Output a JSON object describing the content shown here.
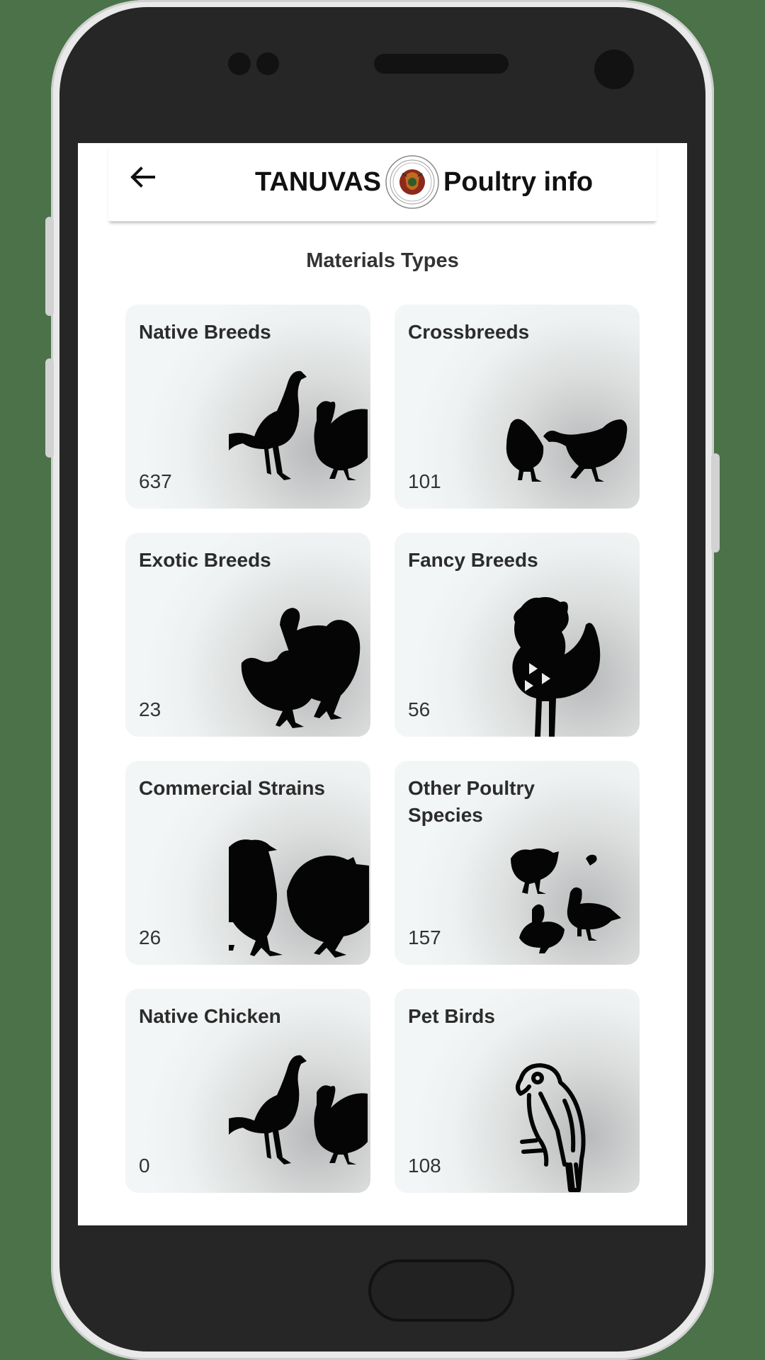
{
  "app_bar": {
    "title_left": "TANUVAS",
    "title_right": "Poultry info",
    "back_icon": "arrow-left-icon",
    "logo": "tanuvas-logo"
  },
  "section_title": "Materials Types",
  "cards": [
    {
      "title": "Native Breeds",
      "count": "637",
      "icon": "native-breeds-icon"
    },
    {
      "title": "Crossbreeds",
      "count": "101",
      "icon": "crossbreeds-icon"
    },
    {
      "title": "Exotic Breeds",
      "count": "23",
      "icon": "exotic-breeds-icon"
    },
    {
      "title": "Fancy Breeds",
      "count": "56",
      "icon": "fancy-breeds-icon"
    },
    {
      "title": "Commercial Strains",
      "count": "26",
      "icon": "commercial-strains-icon"
    },
    {
      "title": "Other Poultry Species",
      "count": "157",
      "icon": "other-poultry-icon"
    },
    {
      "title": "Native Chicken",
      "count": "0",
      "icon": "native-chicken-icon"
    },
    {
      "title": "Pet Birds",
      "count": "108",
      "icon": "parrot-icon"
    }
  ],
  "colors": {
    "background": "#4b7249",
    "device": "#262626",
    "card": "#f3f6f6",
    "text": "#2c2c2c"
  }
}
